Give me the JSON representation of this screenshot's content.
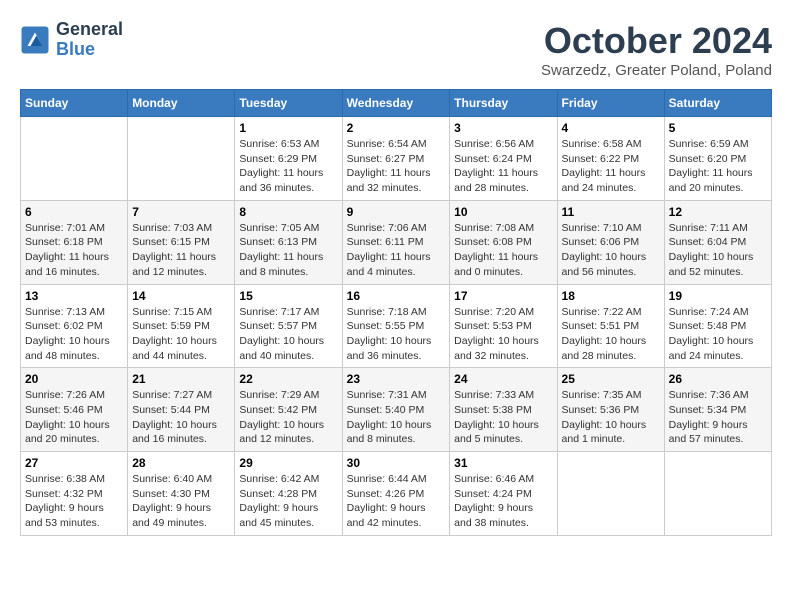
{
  "header": {
    "logo_line1": "General",
    "logo_line2": "Blue",
    "month": "October 2024",
    "location": "Swarzedz, Greater Poland, Poland"
  },
  "weekdays": [
    "Sunday",
    "Monday",
    "Tuesday",
    "Wednesday",
    "Thursday",
    "Friday",
    "Saturday"
  ],
  "weeks": [
    [
      {
        "day": "",
        "info": ""
      },
      {
        "day": "",
        "info": ""
      },
      {
        "day": "1",
        "info": "Sunrise: 6:53 AM\nSunset: 6:29 PM\nDaylight: 11 hours and 36 minutes."
      },
      {
        "day": "2",
        "info": "Sunrise: 6:54 AM\nSunset: 6:27 PM\nDaylight: 11 hours and 32 minutes."
      },
      {
        "day": "3",
        "info": "Sunrise: 6:56 AM\nSunset: 6:24 PM\nDaylight: 11 hours and 28 minutes."
      },
      {
        "day": "4",
        "info": "Sunrise: 6:58 AM\nSunset: 6:22 PM\nDaylight: 11 hours and 24 minutes."
      },
      {
        "day": "5",
        "info": "Sunrise: 6:59 AM\nSunset: 6:20 PM\nDaylight: 11 hours and 20 minutes."
      }
    ],
    [
      {
        "day": "6",
        "info": "Sunrise: 7:01 AM\nSunset: 6:18 PM\nDaylight: 11 hours and 16 minutes."
      },
      {
        "day": "7",
        "info": "Sunrise: 7:03 AM\nSunset: 6:15 PM\nDaylight: 11 hours and 12 minutes."
      },
      {
        "day": "8",
        "info": "Sunrise: 7:05 AM\nSunset: 6:13 PM\nDaylight: 11 hours and 8 minutes."
      },
      {
        "day": "9",
        "info": "Sunrise: 7:06 AM\nSunset: 6:11 PM\nDaylight: 11 hours and 4 minutes."
      },
      {
        "day": "10",
        "info": "Sunrise: 7:08 AM\nSunset: 6:08 PM\nDaylight: 11 hours and 0 minutes."
      },
      {
        "day": "11",
        "info": "Sunrise: 7:10 AM\nSunset: 6:06 PM\nDaylight: 10 hours and 56 minutes."
      },
      {
        "day": "12",
        "info": "Sunrise: 7:11 AM\nSunset: 6:04 PM\nDaylight: 10 hours and 52 minutes."
      }
    ],
    [
      {
        "day": "13",
        "info": "Sunrise: 7:13 AM\nSunset: 6:02 PM\nDaylight: 10 hours and 48 minutes."
      },
      {
        "day": "14",
        "info": "Sunrise: 7:15 AM\nSunset: 5:59 PM\nDaylight: 10 hours and 44 minutes."
      },
      {
        "day": "15",
        "info": "Sunrise: 7:17 AM\nSunset: 5:57 PM\nDaylight: 10 hours and 40 minutes."
      },
      {
        "day": "16",
        "info": "Sunrise: 7:18 AM\nSunset: 5:55 PM\nDaylight: 10 hours and 36 minutes."
      },
      {
        "day": "17",
        "info": "Sunrise: 7:20 AM\nSunset: 5:53 PM\nDaylight: 10 hours and 32 minutes."
      },
      {
        "day": "18",
        "info": "Sunrise: 7:22 AM\nSunset: 5:51 PM\nDaylight: 10 hours and 28 minutes."
      },
      {
        "day": "19",
        "info": "Sunrise: 7:24 AM\nSunset: 5:48 PM\nDaylight: 10 hours and 24 minutes."
      }
    ],
    [
      {
        "day": "20",
        "info": "Sunrise: 7:26 AM\nSunset: 5:46 PM\nDaylight: 10 hours and 20 minutes."
      },
      {
        "day": "21",
        "info": "Sunrise: 7:27 AM\nSunset: 5:44 PM\nDaylight: 10 hours and 16 minutes."
      },
      {
        "day": "22",
        "info": "Sunrise: 7:29 AM\nSunset: 5:42 PM\nDaylight: 10 hours and 12 minutes."
      },
      {
        "day": "23",
        "info": "Sunrise: 7:31 AM\nSunset: 5:40 PM\nDaylight: 10 hours and 8 minutes."
      },
      {
        "day": "24",
        "info": "Sunrise: 7:33 AM\nSunset: 5:38 PM\nDaylight: 10 hours and 5 minutes."
      },
      {
        "day": "25",
        "info": "Sunrise: 7:35 AM\nSunset: 5:36 PM\nDaylight: 10 hours and 1 minute."
      },
      {
        "day": "26",
        "info": "Sunrise: 7:36 AM\nSunset: 5:34 PM\nDaylight: 9 hours and 57 minutes."
      }
    ],
    [
      {
        "day": "27",
        "info": "Sunrise: 6:38 AM\nSunset: 4:32 PM\nDaylight: 9 hours and 53 minutes."
      },
      {
        "day": "28",
        "info": "Sunrise: 6:40 AM\nSunset: 4:30 PM\nDaylight: 9 hours and 49 minutes."
      },
      {
        "day": "29",
        "info": "Sunrise: 6:42 AM\nSunset: 4:28 PM\nDaylight: 9 hours and 45 minutes."
      },
      {
        "day": "30",
        "info": "Sunrise: 6:44 AM\nSunset: 4:26 PM\nDaylight: 9 hours and 42 minutes."
      },
      {
        "day": "31",
        "info": "Sunrise: 6:46 AM\nSunset: 4:24 PM\nDaylight: 9 hours and 38 minutes."
      },
      {
        "day": "",
        "info": ""
      },
      {
        "day": "",
        "info": ""
      }
    ]
  ]
}
